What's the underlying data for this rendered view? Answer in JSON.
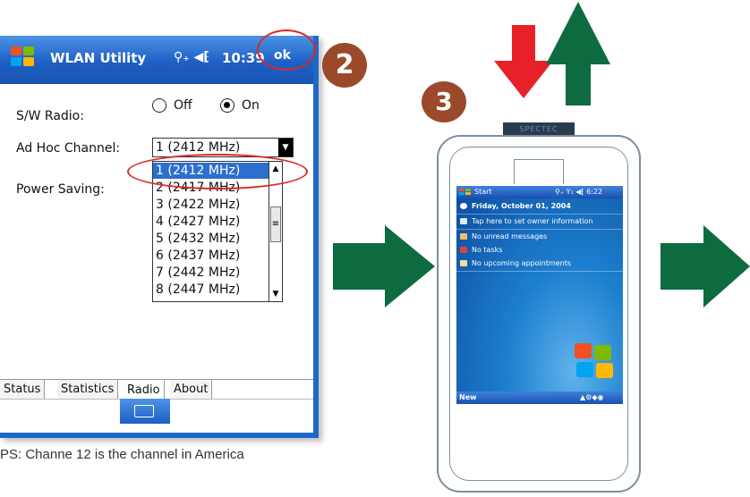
{
  "wlan_window": {
    "title": "WLAN Utility",
    "status_icons": "⚲₊ ◀⁅",
    "time": "10:39",
    "ok_label": "ok"
  },
  "radio_row": {
    "label": "S/W Radio:",
    "options": [
      {
        "label": "Off",
        "selected": false
      },
      {
        "label": "On",
        "selected": true
      }
    ]
  },
  "channel_row": {
    "label": "Ad Hoc Channel:",
    "selected_value": "1  (2412 MHz)",
    "options": [
      "1  (2412 MHz)",
      "2  (2417 MHz)",
      "3  (2422 MHz)",
      "4  (2427 MHz)",
      "5  (2432 MHz)",
      "6  (2437 MHz)",
      "7  (2442 MHz)",
      "8  (2447 MHz)"
    ],
    "highlighted_index": 0
  },
  "power_row": {
    "label": "Power Saving:"
  },
  "tabs": [
    {
      "label": "Status",
      "active": false
    },
    {
      "label": "Statistics",
      "active": false
    },
    {
      "label": "Radio",
      "active": true
    },
    {
      "label": "About",
      "active": false
    }
  ],
  "steps": {
    "two": "2",
    "three": "3"
  },
  "note": "PS: Channe 12 is the channel in America",
  "phone": {
    "card_label": "SPECTEC",
    "start_label": "Start",
    "status": "⚲₊ Y₁ ◀⁅ 6:22",
    "today_items": [
      "Friday, October 01, 2004",
      "Tap here to set owner information",
      "No unread messages",
      "No tasks",
      "No upcoming appointments"
    ],
    "softkey_left": "New"
  },
  "colors": {
    "titlebar_blue": "#1e5fc4",
    "highlight_ring": "#d82a2a",
    "step_badge": "#9a4a2a",
    "arrow_green": "#0e6b40",
    "arrow_red": "#e82128"
  }
}
